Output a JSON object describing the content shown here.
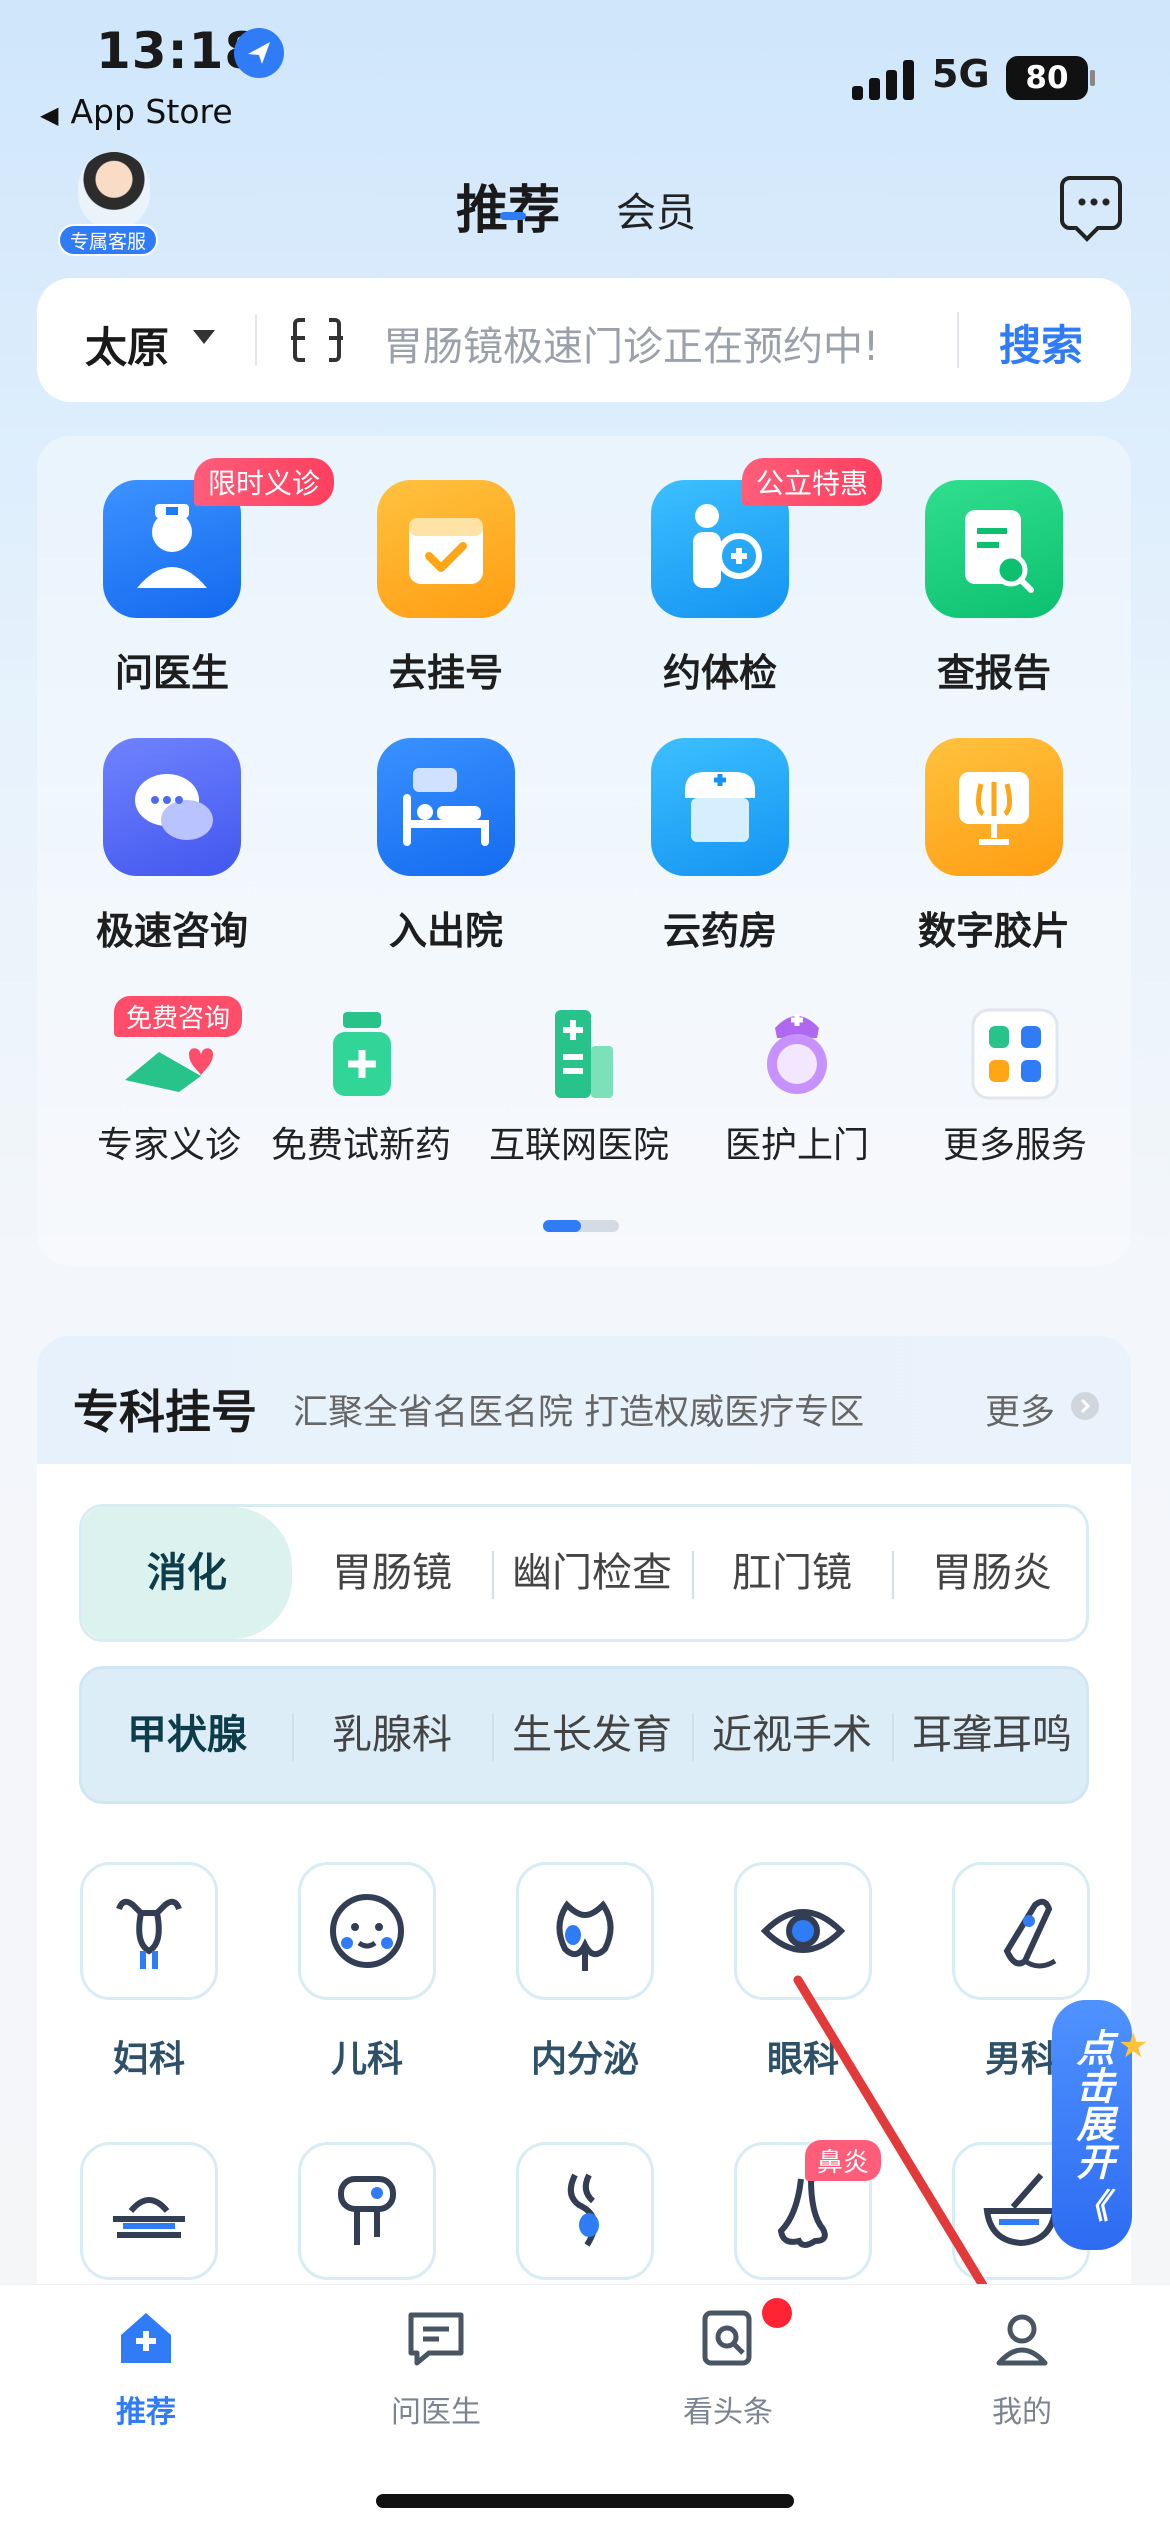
{
  "status_bar": {
    "time": "13:18",
    "back_app": "App Store",
    "network": "5G",
    "battery": "80"
  },
  "header": {
    "avatar_badge": "专属客服",
    "tabs": [
      {
        "label": "推荐",
        "active": true
      },
      {
        "label": "会员",
        "active": false
      }
    ],
    "message_icon": "chat-bubble-icon"
  },
  "search": {
    "city": "太原",
    "placeholder": "胃肠镜极速门诊正在预约中!",
    "button": "搜索"
  },
  "services": {
    "primary": [
      {
        "label": "问医生",
        "badge": "限时义诊",
        "icon": "doctor-icon",
        "color": "#1e7cf6"
      },
      {
        "label": "去挂号",
        "badge": "",
        "icon": "calendar-check-icon",
        "color": "#ffad1f"
      },
      {
        "label": "约体检",
        "badge": "公立特惠",
        "icon": "checkup-person-icon",
        "color": "#1aa3f5"
      },
      {
        "label": "查报告",
        "badge": "",
        "icon": "report-search-icon",
        "color": "#12cc7b"
      },
      {
        "label": "极速咨询",
        "badge": "",
        "icon": "chat-consult-icon",
        "color": "#4e6af5"
      },
      {
        "label": "入出院",
        "badge": "",
        "icon": "hospital-bed-icon",
        "color": "#1e7cf6"
      },
      {
        "label": "云药房",
        "badge": "",
        "icon": "pharmacy-icon",
        "color": "#1aa3f5"
      },
      {
        "label": "数字胶片",
        "badge": "",
        "icon": "xray-film-icon",
        "color": "#ffad1f"
      }
    ],
    "secondary": [
      {
        "label": "专家义诊",
        "badge": "免费咨询",
        "icon": "heart-hand-icon"
      },
      {
        "label": "免费试新药",
        "badge": "",
        "icon": "medicine-bottle-icon"
      },
      {
        "label": "互联网医院",
        "badge": "",
        "icon": "online-hospital-icon"
      },
      {
        "label": "医护上门",
        "badge": "",
        "icon": "nurse-icon"
      },
      {
        "label": "更多服务",
        "badge": "",
        "icon": "more-services-icon"
      }
    ]
  },
  "specialty": {
    "title": "专科挂号",
    "subtitle": "汇聚全省名医名院 打造权威医疗专区",
    "more": "更多",
    "row1": [
      "消化",
      "胃肠镜",
      "幽门检查",
      "肛门镜",
      "胃肠炎"
    ],
    "row2": [
      "甲状腺",
      "乳腺科",
      "生长发育",
      "近视手术",
      "耳聋耳鸣"
    ],
    "departments": [
      {
        "label": "妇科",
        "badge": "",
        "icon": "uterus-icon"
      },
      {
        "label": "儿科",
        "badge": "",
        "icon": "baby-face-icon"
      },
      {
        "label": "内分泌",
        "badge": "",
        "icon": "thyroid-icon"
      },
      {
        "label": "眼科",
        "badge": "",
        "icon": "eye-icon"
      },
      {
        "label": "男科",
        "badge": "",
        "icon": "male-health-icon"
      },
      {
        "label": "",
        "badge": "",
        "icon": "skin-layer-icon"
      },
      {
        "label": "",
        "badge": "",
        "icon": "dental-icon"
      },
      {
        "label": "",
        "badge": "",
        "icon": "pregnancy-icon"
      },
      {
        "label": "",
        "badge": "鼻炎",
        "icon": "nose-icon"
      },
      {
        "label": "",
        "badge": "",
        "icon": "mortar-icon"
      }
    ]
  },
  "float_button": {
    "label": "点击展开",
    "chevrons": "《"
  },
  "tabbar": [
    {
      "label": "推荐",
      "icon": "home-plus-icon",
      "active": true
    },
    {
      "label": "问医生",
      "icon": "chat-doc-icon",
      "active": false
    },
    {
      "label": "看头条",
      "icon": "news-icon",
      "active": false
    },
    {
      "label": "我的",
      "icon": "profile-icon",
      "active": false
    }
  ],
  "colors": {
    "accent": "#2f7cf6",
    "badge_red": "#ff4d6a",
    "annotation_arrow": "#e2393b"
  }
}
